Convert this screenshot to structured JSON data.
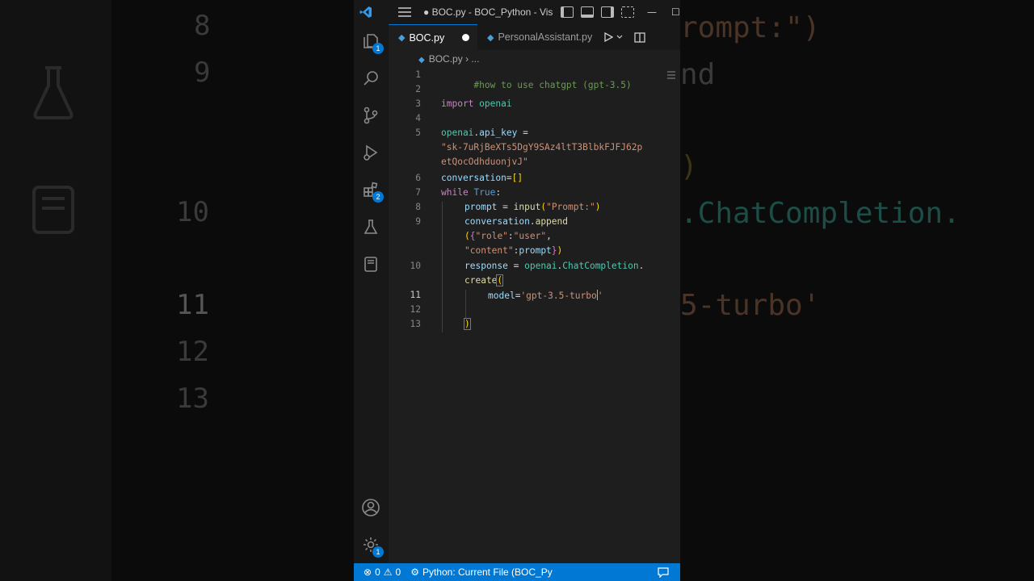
{
  "window": {
    "title": "● BOC.py - BOC_Python - Vis..."
  },
  "activity_bar": {
    "explorer_badge": "1",
    "extensions_badge": "2",
    "settings_badge": "1"
  },
  "tabs": [
    {
      "label": "BOC.py",
      "modified": true
    },
    {
      "label": "PersonalAssistant.py"
    }
  ],
  "breadcrumb": {
    "file": "BOC.py",
    "more": "..."
  },
  "editor": {
    "line_numbers": [
      "1",
      "2",
      "3",
      "4",
      "5",
      "6",
      "7",
      "8",
      "9",
      "10",
      "11",
      "12",
      "13"
    ],
    "current_line": "11",
    "lines": {
      "l1": "#how to use chatgpt (gpt-3.5)",
      "l3_kw": "import",
      "l3_mod": "openai",
      "l5a_obj": "openai",
      "l5a_attr": "api_key",
      "l5a_op": " =",
      "l5b_str": "\"sk-7uRjBeXTs5DgY9SAz4ltT3BlbkFJFJ62p",
      "l5c_str": "etQocOdhduonjvJ\"",
      "l6_var": "conversation",
      "l6_rest": "=[]",
      "l7_kw": "while",
      "l7_true": "True",
      "l7_colon": ":",
      "l8_var": "prompt",
      "l8_op": " = ",
      "l8_fn": "input",
      "l8_str": "\"Prompt:\"",
      "l9a_var": "conversation",
      "l9a_fn": "append",
      "l9b_str1": "\"role\"",
      "l9b_str2": "\"user\"",
      "l9c_str": "\"content\"",
      "l9c_var": "prompt",
      "l10a_var": "response",
      "l10a_op": " = ",
      "l10a_obj": "openai",
      "l10a_cls": "ChatCompletion",
      "l10b_fn": "create",
      "l11_param": "model",
      "l11_str": "'gpt-3.5-turbo",
      "l11_end": "'"
    }
  },
  "status_bar": {
    "errors": "0",
    "warnings": "0",
    "run_config": "Python: Current File (BOC_Py"
  },
  "background": {
    "left_numbers": [
      "8",
      "9",
      "10",
      "11",
      "12",
      "13"
    ],
    "right_code": [
      "rompt:\")",
      "nd",
      ")",
      ".ChatCompletion.",
      "5-turbo'"
    ]
  },
  "colors": {
    "accent": "#0078d4",
    "editor_bg": "#1e1e1e",
    "sidebar_bg": "#181818"
  }
}
